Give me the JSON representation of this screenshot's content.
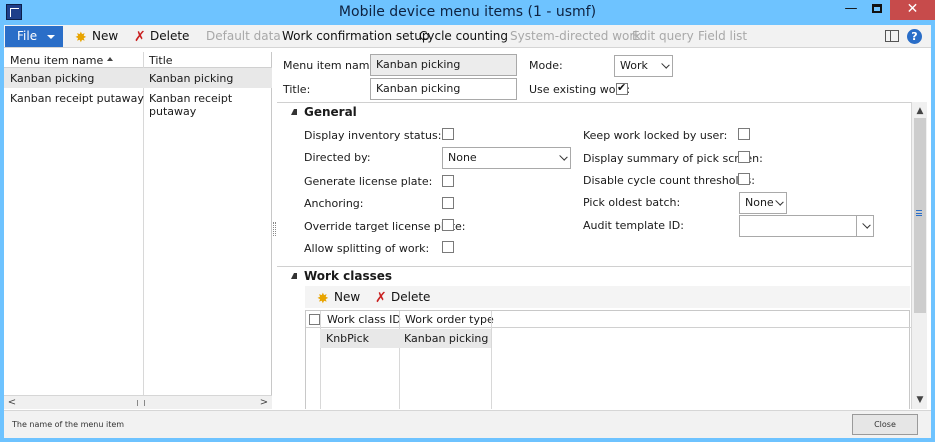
{
  "window": {
    "title": "Mobile device menu items (1 - usmf)",
    "minimize": "—",
    "close": "✕"
  },
  "colors": {
    "titlebar": "#6ec3ff",
    "accent": "#2a6ec8",
    "close_button": "#c74b4b",
    "new_icon": "#e8a400",
    "delete_icon": "#c92020"
  },
  "toolbar": {
    "file_label": "File",
    "new_label": "New",
    "delete_label": "Delete",
    "default_data_label": "Default data",
    "work_confirmation_label": "Work confirmation setup",
    "cycle_counting_label": "Cycle counting",
    "system_directed_label": "System-directed work",
    "edit_query_label": "Edit query",
    "field_list_label": "Field list",
    "help_label": "?"
  },
  "list": {
    "columns": [
      "Menu item name",
      "Title"
    ],
    "rows": [
      {
        "name": "Kanban picking",
        "title": "Kanban picking"
      },
      {
        "name": "Kanban receipt putaway",
        "title": "Kanban receipt putaway"
      }
    ],
    "selected_index": 0
  },
  "header": {
    "menu_item_name_label": "Menu item name:",
    "menu_item_name_value": "Kanban picking",
    "title_label": "Title:",
    "title_value": "Kanban picking",
    "mode_label": "Mode:",
    "mode_value": "Work",
    "use_existing_work_label": "Use existing work:",
    "use_existing_work_checked": true
  },
  "general": {
    "title": "General",
    "display_inventory_status_label": "Display inventory status:",
    "directed_by_label": "Directed by:",
    "directed_by_value": "None",
    "generate_license_plate_label": "Generate license plate:",
    "anchoring_label": "Anchoring:",
    "override_target_lp_label": "Override target license plate:",
    "allow_splitting_label": "Allow splitting of work:",
    "keep_work_locked_label": "Keep work locked by user:",
    "display_summary_label": "Display summary of pick screen:",
    "disable_cycle_count_label": "Disable cycle count thresholds:",
    "pick_oldest_batch_label": "Pick oldest batch:",
    "pick_oldest_batch_value": "None",
    "audit_template_label": "Audit template ID:",
    "audit_template_value": ""
  },
  "work_classes": {
    "title": "Work classes",
    "new_label": "New",
    "delete_label": "Delete",
    "columns": [
      "Work class ID",
      "Work order type"
    ],
    "rows": [
      {
        "work_class_id": "KnbPick",
        "work_order_type": "Kanban picking"
      }
    ]
  },
  "status": {
    "text": "The name of the menu item",
    "close_label": "Close"
  }
}
